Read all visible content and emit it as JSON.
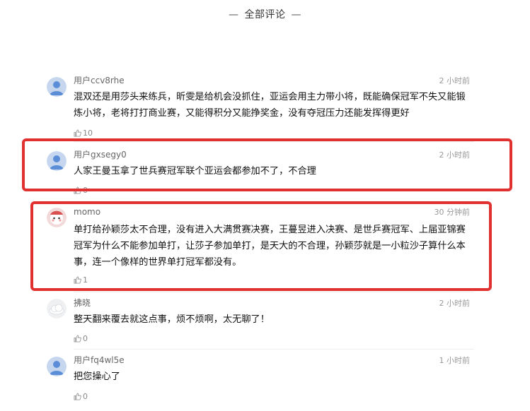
{
  "header": {
    "title": "全部评论",
    "dash_left": "—",
    "dash_right": "—"
  },
  "highlight_color": "#e03030",
  "comments": [
    {
      "user": "用户ccv8rhe",
      "time": "2 小时前",
      "text": "混双还是用莎头来练兵，昕雯是给机会没抓住，亚运会用主力带小将，既能确保冠军不失又能锻炼小将，老将打打商业赛，又能得积分又能挣奖金，没有夺冠压力还能发挥得更好",
      "likes": "10",
      "avatar": "default-user-avatar"
    },
    {
      "user": "用户gxsegy0",
      "time": "2 小时前",
      "text": "人家王曼玉拿了世兵赛冠军联个亚运会都参加不了，不合理",
      "likes": "0",
      "avatar": "default-user-avatar"
    },
    {
      "user": "momo",
      "time": "30 分钟前",
      "text": "单打给孙颖莎太不合理，没有进入大满贯赛决赛，王蔓昱进入决赛、是世乒赛冠军、上届亚锦赛冠军为什么不能参加单打，让莎子参加单打，是天大的不合理，孙颖莎就是一小粒沙子算什么本事，连一个像样的世界单打冠军都没有。",
      "likes": "1",
      "avatar": "cartoon-avatar"
    },
    {
      "user": "拂晓",
      "time": "2 小时前",
      "text": "整天翻来覆去就这点事，烦不烦啊，太无聊了！",
      "likes": "0",
      "avatar": "cloud-avatar"
    },
    {
      "user": "用户fq4wl5e",
      "time": "1 小时前",
      "text": "把您操心了",
      "likes": "0",
      "avatar": "default-user-avatar"
    }
  ]
}
